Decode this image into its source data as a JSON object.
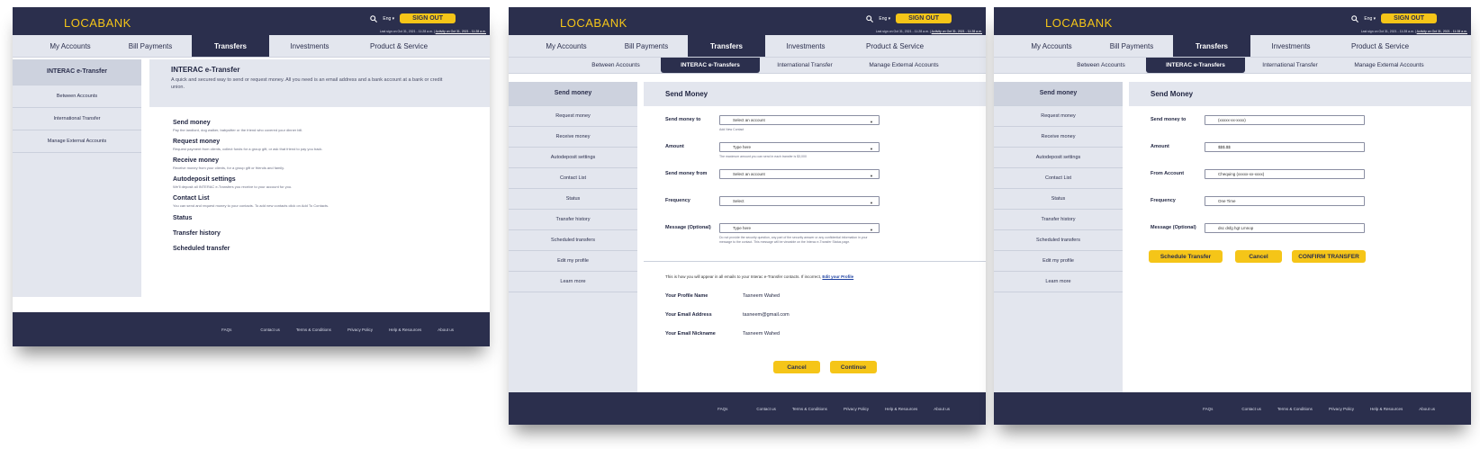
{
  "brand": {
    "logo": "LOCABANK"
  },
  "header": {
    "lang": "Eng ▾",
    "sign_out": "SIGN OUT",
    "last_sign": "Last sign on Oct 31, 2021 - 11:28 a.m.",
    "activity": "Activity on Oct 31, 2021 - 11:28 a.m."
  },
  "main_nav": [
    "My Accounts",
    "Bill Payments",
    "Transfers",
    "Investments",
    "Product & Service"
  ],
  "sub_nav": [
    "Between Accounts",
    "INTERAC e-Transfers",
    "International Transfer",
    "Manage External Accounts"
  ],
  "footer": [
    "FAQs",
    "Contact us",
    "Terms & Conditions",
    "Privacy Policy",
    "Help & Resources",
    "About us"
  ],
  "screen1": {
    "sidebar": [
      "INTERAC e-Transfer",
      "Between Accounts",
      "International Transfer",
      "Manage External Accounts"
    ],
    "hero_title": "INTERAC e-Transfer",
    "hero_text": "A quick and secured way to send or request money. All you need is an email address and a bank account at a bank or credit union.",
    "features": [
      {
        "title": "Send money",
        "desc": "Pay the landlord, dog walker, babysitter or the friend who covered your dinner bill."
      },
      {
        "title": "Request money",
        "desc": "Request payment from clients, collect funds for a group gift, or ask that friend to pay you back."
      },
      {
        "title": "Receive money",
        "desc": "Receive money from your clients, for a group gift or friends and family."
      },
      {
        "title": "Autodeposit settings",
        "desc": "We'll deposit all INTERAC e-Transfers you receive to your account for you."
      },
      {
        "title": "Contact List",
        "desc": "You can send and request money to your contacts. To add new contacts click on Add To Contacts."
      },
      {
        "title": "Status",
        "desc": ""
      },
      {
        "title": "Transfer history",
        "desc": ""
      },
      {
        "title": "Scheduled transfer",
        "desc": ""
      }
    ]
  },
  "side_menu": [
    "Send money",
    "Request money",
    "Receive money",
    "Autodeposit settings",
    "Contact List",
    "Status",
    "Transfer history",
    "Scheduled transfers",
    "Edit my profile",
    "Learn more"
  ],
  "screen2": {
    "title": "Send Money",
    "labels": [
      "Send money to",
      "Amount",
      "Send money from",
      "Frequency",
      "Message (Optional)"
    ],
    "fields": [
      "Select an account",
      "Type here",
      "Select an account",
      "Select",
      "Type here"
    ],
    "hints": [
      "Add New Contact",
      "The maximum amount you can send in each transfer is $3,000",
      "",
      "",
      "Do not provide the security question, any part of the security answer or any confidential information in your message to the contact. This message will be viewable on the Interac e-Transfer Status page."
    ],
    "appear_text": "This is how you will appear in all emails to your Interac e-Transfer contacts. If incorrect,",
    "edit_profile": "Edit your Profile",
    "profile": [
      {
        "label": "Your Profile Name",
        "value": "Tasneem Wahed"
      },
      {
        "label": "Your Email Address",
        "value": "tasneem@gmail.com"
      },
      {
        "label": "Your Email Nickname",
        "value": "Tasneem Wahed"
      }
    ],
    "cancel": "Cancel",
    "continue": "Continue"
  },
  "screen3": {
    "title": "Send Money",
    "labels": [
      "Send money to",
      "Amount",
      "From Account",
      "Frequency",
      "Message (Optional)"
    ],
    "values": [
      "(xxxxx-xx-xxxx)",
      "$$$.$$",
      "Chequing (xxxxx-xx-xxxx)",
      "One Time",
      "dsc dsfg hgt Lmnop"
    ],
    "schedule": "Schedule Transfer",
    "cancel": "Cancel",
    "confirm": "CONFIRM TRANSFER"
  },
  "colors": {
    "navy": "#2b2f4d",
    "accent": "#f5c518",
    "panel": "#e3e6ee"
  }
}
